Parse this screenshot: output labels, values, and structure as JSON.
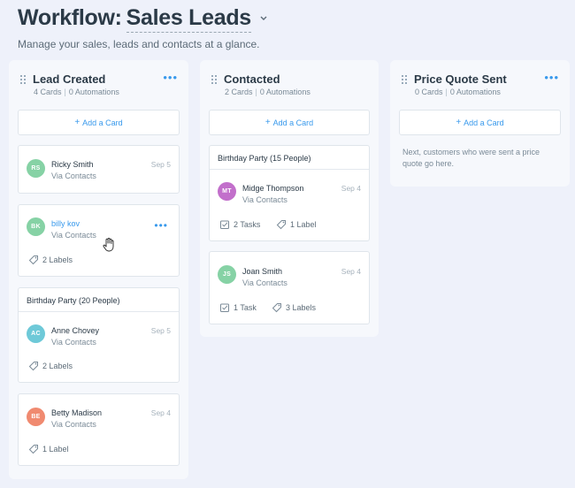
{
  "header": {
    "title_prefix": "Workflow:",
    "title_name": "Sales Leads",
    "subtitle": "Manage your sales, leads and contacts at a glance."
  },
  "colors": {
    "accent": "#3899ec",
    "background": "#eef1fa"
  },
  "add_card_label": "Add a Card",
  "columns": [
    {
      "title": "Lead Created",
      "cards_count": "4 Cards",
      "automations_count": "0 Automations",
      "cards": [
        {
          "initials": "RS",
          "avatar_color": "#86d2a5",
          "name": "Ricky Smith",
          "source": "Via Contacts",
          "date": "Sep 5"
        },
        {
          "initials": "BK",
          "avatar_color": "#86d2a5",
          "name": "billy kov",
          "source": "Via Contacts",
          "labels": "2 Labels"
        },
        {
          "group": "Birthday Party (20 People)",
          "initials": "AC",
          "avatar_color": "#6ec9d8",
          "name": "Anne Chovey",
          "source": "Via Contacts",
          "date": "Sep 5",
          "labels": "2 Labels"
        },
        {
          "initials": "BE",
          "avatar_color": "#f08a70",
          "name": "Betty Madison",
          "source": "Via Contacts",
          "date": "Sep 4",
          "labels": "1 Label"
        }
      ]
    },
    {
      "title": "Contacted",
      "cards_count": "2 Cards",
      "automations_count": "0 Automations",
      "cards": [
        {
          "group": "Birthday Party (15 People)",
          "initials": "MT",
          "avatar_color": "#c26fcb",
          "name": "Midge Thompson",
          "source": "Via Contacts",
          "date": "Sep 4",
          "tasks": "2 Tasks",
          "labels": "1 Label"
        },
        {
          "initials": "JS",
          "avatar_color": "#86d2a5",
          "name": "Joan Smith",
          "source": "Via Contacts",
          "date": "Sep 4",
          "tasks": "1 Task",
          "labels": "3 Labels"
        }
      ]
    },
    {
      "title": "Price Quote Sent",
      "cards_count": "0 Cards",
      "automations_count": "0 Automations",
      "empty_text": "Next, customers who were sent a price quote go here."
    }
  ]
}
